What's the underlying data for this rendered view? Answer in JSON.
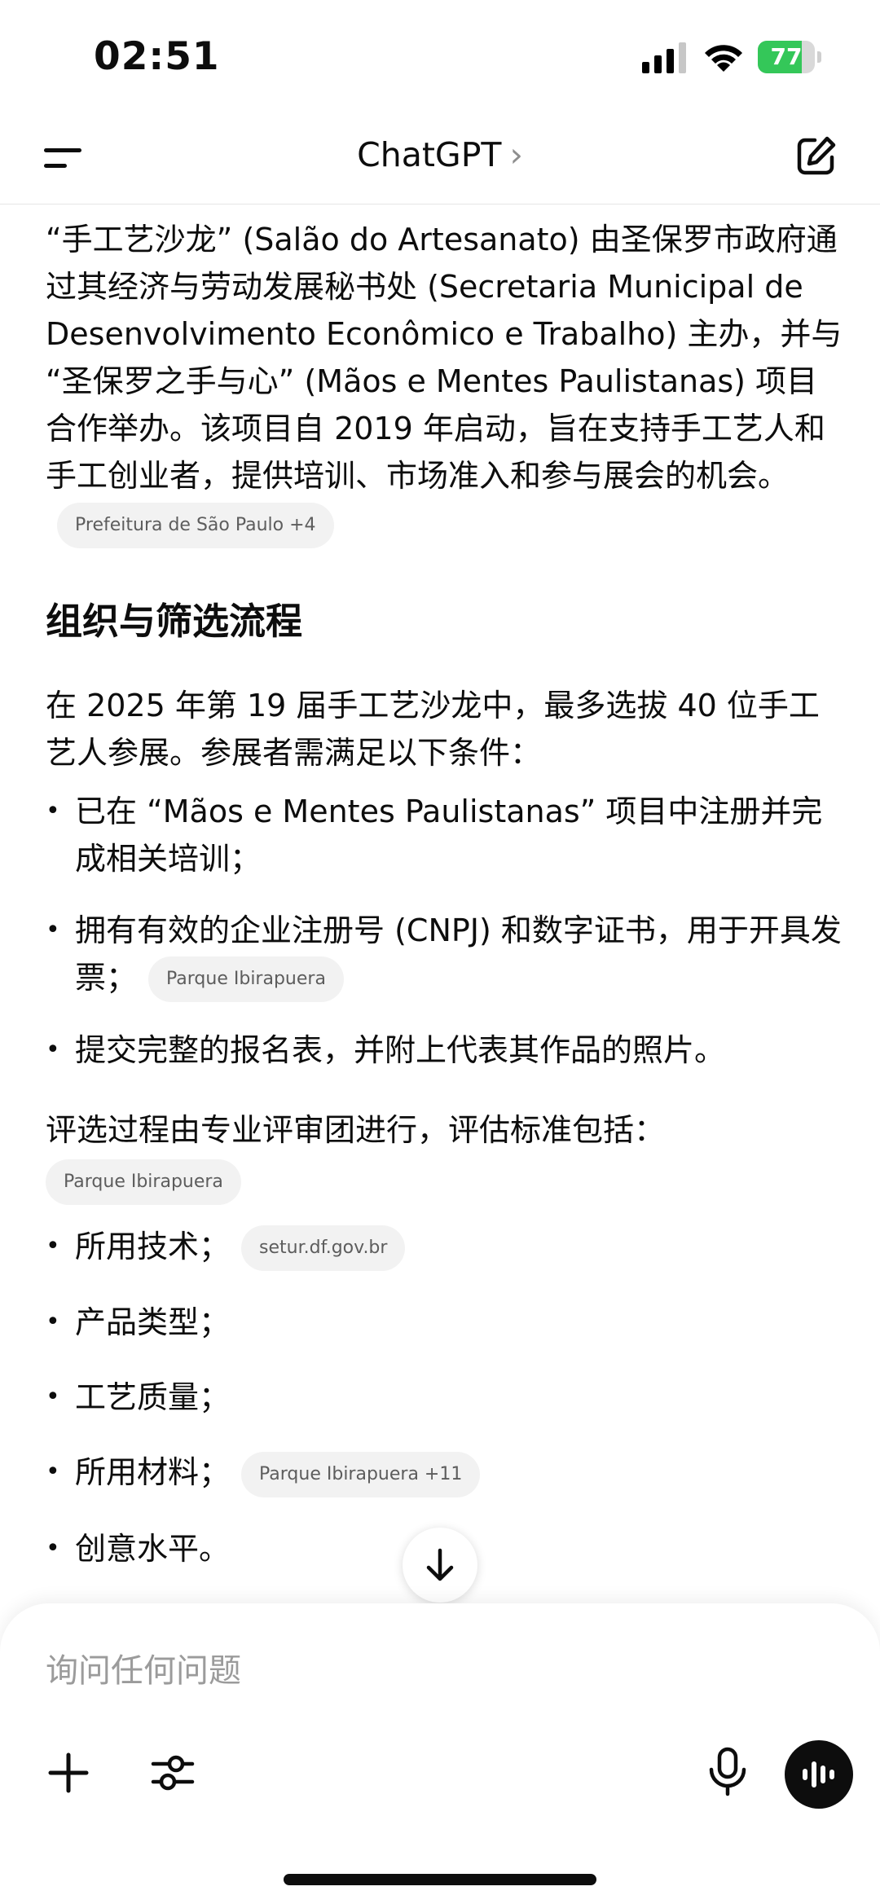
{
  "status_bar": {
    "time": "02:51",
    "battery": "77",
    "battery_level": 0.77,
    "battery_color": "#34c759"
  },
  "header": {
    "menu_icon": "menu-icon",
    "title": "ChatGPT",
    "chevron": "›",
    "edit_icon": "new-chat-edit-icon"
  },
  "message": {
    "para1": "“手工艺沙龙” (Salão do Artesanato) 由圣保罗市政府通过其经济与劳动发展秘书处 (Secretaria Municipal de Desenvolvimento Econômico e Trabalho) 主办，并与 “圣保罗之手与心” (Mãos e Mentes Paulistanas) 项目合作举办。该项目自 2019 年启动，旨在支持手工艺人和手工创业者，提供培训、市场准入和参与展会的机会。",
    "para1_chip": "Prefeitura de São Paulo +4",
    "section_title": "组织与筛选流程",
    "para2": "在 2025 年第 19 届手工艺沙龙中，最多选拔 40 位手工艺人参展。参展者需满足以下条件：",
    "requirements": [
      {
        "text": "已在 “Mãos e Mentes Paulistanas” 项目中注册并完成相关培训；",
        "chip": ""
      },
      {
        "text": "拥有有效的企业注册号 (CNPJ) 和数字证书，用于开具发票；",
        "chip": "Parque Ibirapuera"
      },
      {
        "text": "提交完整的报名表，并附上代表其作品的照片。",
        "chip": ""
      }
    ],
    "para3": "评选过程由专业评审团进行，评估标准包括：",
    "para3_chip": "Parque Ibirapuera",
    "criteria": [
      {
        "text": "所用技术；",
        "chip": "setur.df.gov.br"
      },
      {
        "text": "产品类型；",
        "chip": ""
      },
      {
        "text": "工艺质量；",
        "chip": ""
      },
      {
        "text": "所用材料；",
        "chip": "Parque Ibirapuera +11"
      },
      {
        "text": "创意水平。",
        "chip": ""
      }
    ]
  },
  "scroll_button_icon": "arrow-down-icon",
  "composer": {
    "placeholder": "询问任何问题",
    "plus_icon": "plus-icon",
    "tools_icon": "sliders-icon",
    "mic_icon": "microphone-icon",
    "voice_icon": "voice-waveform-icon"
  }
}
